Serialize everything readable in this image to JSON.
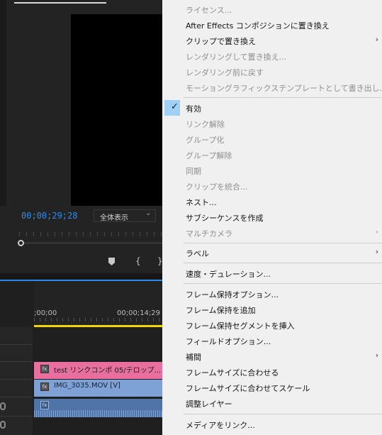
{
  "monitor": {
    "timecode": "00;00;29;28",
    "zoom": "全体表示"
  },
  "timeline": {
    "ruler_start": ";00;00",
    "ruler_mid": "00;00;14;29",
    "clips": {
      "pink_label": "test リンクコンポ  05/テロップ...",
      "blue_label": "IMG_3035.MOV [V]",
      "fx_badge": "fx"
    }
  },
  "context_menu": {
    "items": [
      {
        "label": "ライセンス...",
        "enabled": false
      },
      {
        "label": "After Effects コンポジションに置き換え",
        "enabled": true
      },
      {
        "label": "クリップで置き換え",
        "enabled": true,
        "submenu": true
      },
      {
        "label": "レンダリングして置き換え...",
        "enabled": false
      },
      {
        "label": "レンダリング前に戻す",
        "enabled": false
      },
      {
        "label": "モーショングラフィックステンプレートとして書き出し...",
        "enabled": false
      },
      {
        "label": "有効",
        "enabled": true,
        "checked": true
      },
      {
        "label": "リンク解除",
        "enabled": false
      },
      {
        "label": "グループ化",
        "enabled": false
      },
      {
        "label": "グループ解除",
        "enabled": false
      },
      {
        "label": "同期",
        "enabled": false
      },
      {
        "label": "クリップを統合...",
        "enabled": false
      },
      {
        "label": "ネスト...",
        "enabled": true
      },
      {
        "label": "サブシーケンスを作成",
        "enabled": true
      },
      {
        "label": "マルチカメラ",
        "enabled": false,
        "submenu": true
      },
      {
        "label": "ラベル",
        "enabled": true,
        "submenu": true
      },
      {
        "label": "速度・デュレーション...",
        "enabled": true
      },
      {
        "label": "フレーム保持オプション...",
        "enabled": true
      },
      {
        "label": "フレーム保持を追加",
        "enabled": true
      },
      {
        "label": "フレーム保持セグメントを挿入",
        "enabled": true
      },
      {
        "label": "フィールドオプション...",
        "enabled": true
      },
      {
        "label": "補間",
        "enabled": true,
        "submenu": true
      },
      {
        "label": "フレームサイズに合わせる",
        "enabled": true
      },
      {
        "label": "フレームサイズに合わせてスケール",
        "enabled": true
      },
      {
        "label": "調整レイヤー",
        "enabled": true
      },
      {
        "label": "メディアをリンク...",
        "enabled": true
      }
    ],
    "checkmark_icon": "checkmark-icon",
    "submenu_icon": "chevron-right-icon"
  }
}
